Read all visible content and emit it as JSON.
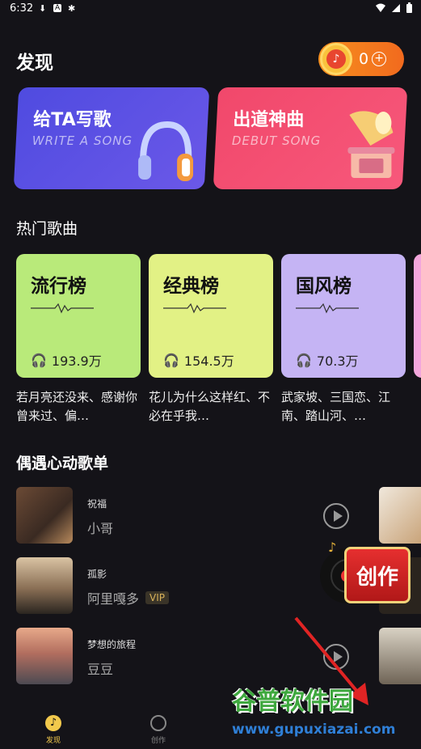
{
  "status": {
    "time": "6:32"
  },
  "page_title": "发现",
  "coins": {
    "value": "0"
  },
  "feature_cards": [
    {
      "title": "给TA写歌",
      "subtitle": "WRITE A SONG"
    },
    {
      "title": "出道神曲",
      "subtitle": "DEBUT SONG"
    }
  ],
  "hot_section": {
    "title": "热门歌曲"
  },
  "charts": [
    {
      "name": "流行榜",
      "plays": "193.9万",
      "desc": "若月亮还没来、感谢你曾来过、偏…",
      "color": "#b9ea7a"
    },
    {
      "name": "经典榜",
      "plays": "154.5万",
      "desc": "花儿为什么这样红、不必在乎我…",
      "color": "#e2f185"
    },
    {
      "name": "国风榜",
      "plays": "70.3万",
      "desc": "武家坡、三国恋、江南、踏山河、…",
      "color": "#c5b4f4"
    }
  ],
  "playlist_section": {
    "title": "偶遇心动歌单"
  },
  "playlists": [
    {
      "title": "祝福",
      "artist": "小哥",
      "vip": ""
    },
    {
      "title": "孤影",
      "artist": "阿里嘎多",
      "vip": "VIP"
    },
    {
      "title": "梦想的旅程",
      "artist": "豆豆",
      "vip": ""
    }
  ],
  "create_badge": "创作",
  "watermark": {
    "brand": "谷普软件园",
    "url": "www.gupuxiazai.com"
  },
  "bottom_nav": [
    {
      "label": "发现",
      "icon": "music-note-icon"
    },
    {
      "label": "创作",
      "icon": "record-icon"
    }
  ]
}
